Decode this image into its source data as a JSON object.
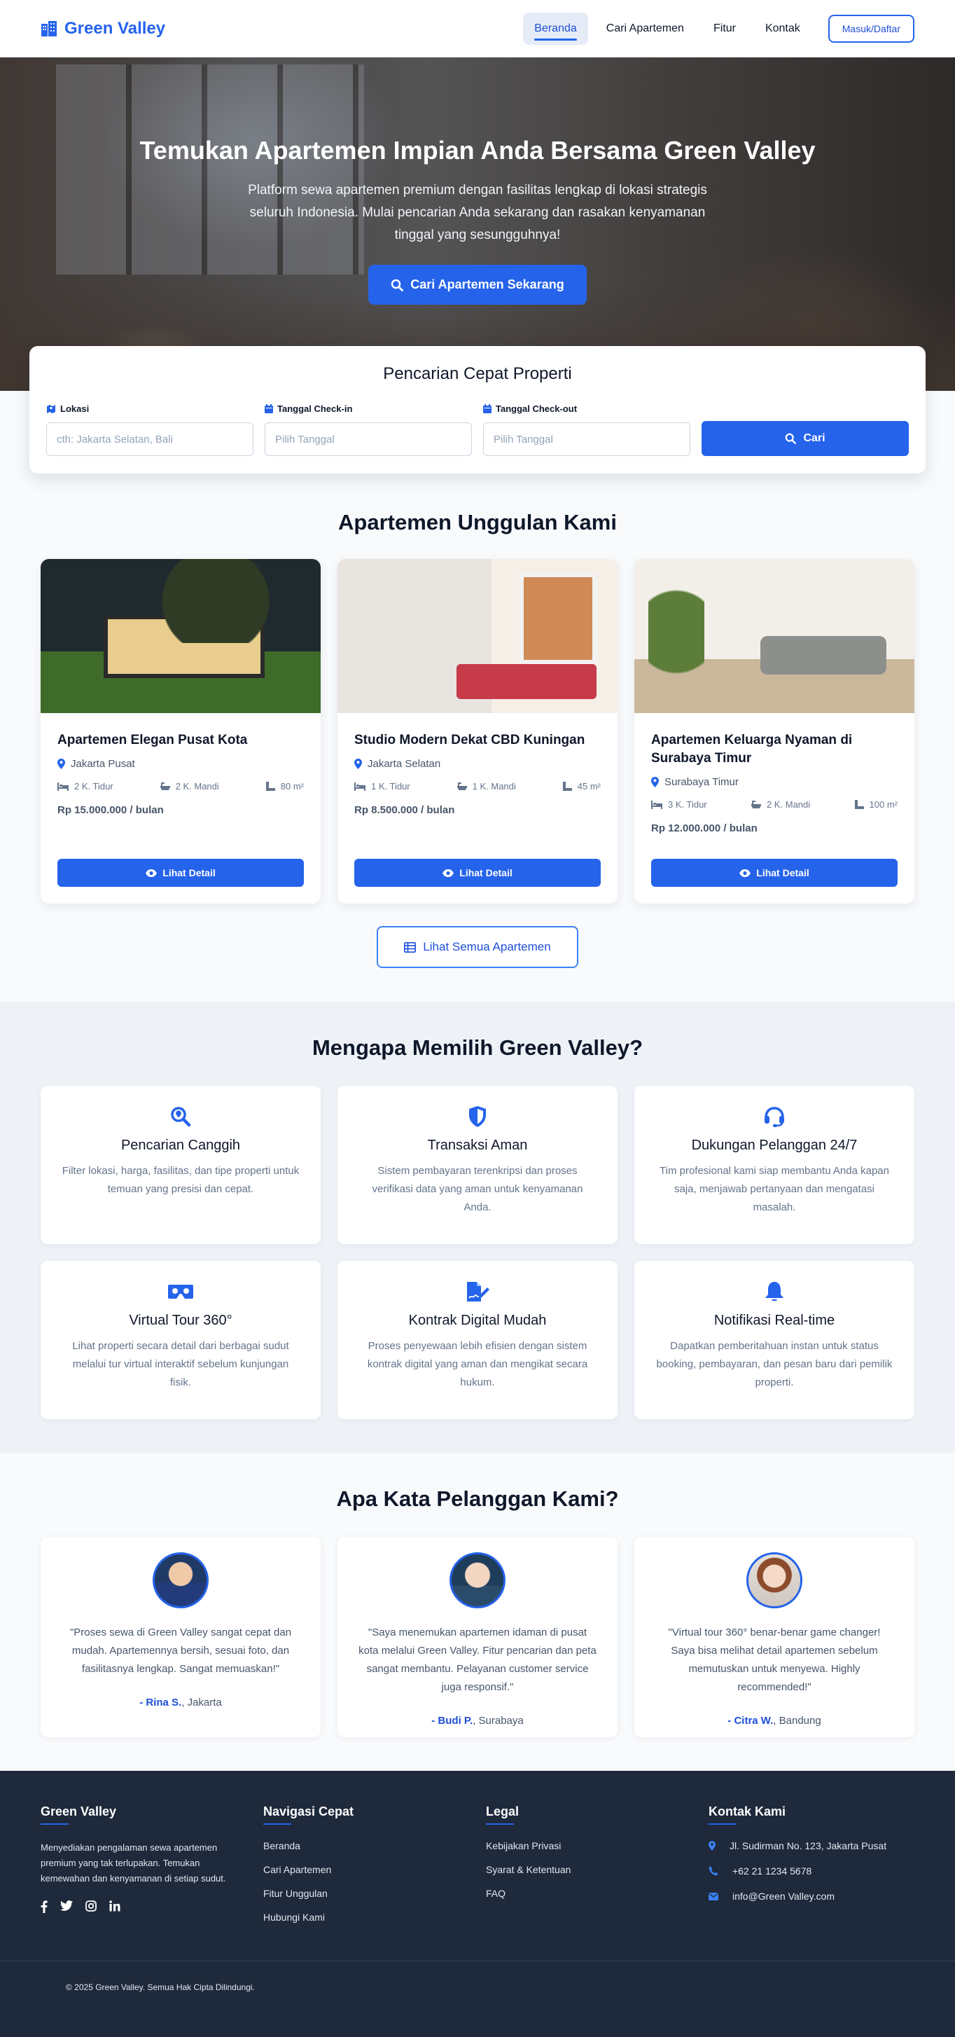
{
  "header": {
    "brand": "Green Valley",
    "nav": [
      "Beranda",
      "Cari Apartemen",
      "Fitur",
      "Kontak"
    ],
    "login": "Masuk/Daftar"
  },
  "hero": {
    "title": "Temukan Apartemen Impian Anda Bersama Green Valley",
    "subtitle": "Platform sewa apartemen premium dengan fasilitas lengkap di lokasi strategis seluruh Indonesia. Mulai pencarian Anda sekarang dan rasakan kenyamanan tinggal yang sesungguhnya!",
    "cta": "Cari Apartemen Sekarang"
  },
  "search": {
    "title": "Pencarian Cepat Properti",
    "location_label": "Lokasi",
    "location_placeholder": "cth: Jakarta Selatan, Bali",
    "checkin_label": "Tanggal Check-in",
    "checkin_placeholder": "Pilih Tanggal",
    "checkout_label": "Tanggal Check-out",
    "checkout_placeholder": "Pilih Tanggal",
    "button": "Cari"
  },
  "featured": {
    "title": "Apartemen Unggulan Kami",
    "cards": [
      {
        "title": "Apartemen Elegan Pusat Kota",
        "location": "Jakarta Pusat",
        "beds": "2 K. Tidur",
        "baths": "2 K. Mandi",
        "area": "80 m²",
        "price": "Rp 15.000.000 / bulan",
        "button": "Lihat Detail"
      },
      {
        "title": "Studio Modern Dekat CBD Kuningan",
        "location": "Jakarta Selatan",
        "beds": "1 K. Tidur",
        "baths": "1 K. Mandi",
        "area": "45 m²",
        "price": "Rp 8.500.000 / bulan",
        "button": "Lihat Detail"
      },
      {
        "title": "Apartemen Keluarga Nyaman di Surabaya Timur",
        "location": "Surabaya Timur",
        "beds": "3 K. Tidur",
        "baths": "2 K. Mandi",
        "area": "100 m²",
        "price": "Rp 12.000.000 / bulan",
        "button": "Lihat Detail"
      }
    ],
    "all_button": "Lihat Semua Apartemen"
  },
  "why": {
    "title": "Mengapa Memilih Green Valley?",
    "items": [
      {
        "title": "Pencarian Canggih",
        "desc": "Filter lokasi, harga, fasilitas, dan tipe properti untuk temuan yang presisi dan cepat."
      },
      {
        "title": "Transaksi Aman",
        "desc": "Sistem pembayaran terenkripsi dan proses verifikasi data yang aman untuk kenyamanan Anda."
      },
      {
        "title": "Dukungan Pelanggan 24/7",
        "desc": "Tim profesional kami siap membantu Anda kapan saja, menjawab pertanyaan dan mengatasi masalah."
      },
      {
        "title": "Virtual Tour 360°",
        "desc": "Lihat properti secara detail dari berbagai sudut melalui tur virtual interaktif sebelum kunjungan fisik."
      },
      {
        "title": "Kontrak Digital Mudah",
        "desc": "Proses penyewaan lebih efisien dengan sistem kontrak digital yang aman dan mengikat secara hukum."
      },
      {
        "title": "Notifikasi Real-time",
        "desc": "Dapatkan pemberitahuan instan untuk status booking, pembayaran, dan pesan baru dari pemilik properti."
      }
    ]
  },
  "testimonials": {
    "title": "Apa Kata Pelanggan Kami?",
    "items": [
      {
        "quote": "\"Proses sewa di Green Valley sangat cepat dan mudah. Apartemennya bersih, sesuai foto, dan fasilitasnya lengkap. Sangat memuaskan!\"",
        "name": "- Rina S.",
        "city": ", Jakarta"
      },
      {
        "quote": "\"Saya menemukan apartemen idaman di pusat kota melalui Green Valley. Fitur pencarian dan peta sangat membantu. Pelayanan customer service juga responsif.\"",
        "name": "- Budi P.",
        "city": ", Surabaya"
      },
      {
        "quote": "\"Virtual tour 360° benar-benar game changer! Saya bisa melihat detail apartemen sebelum memutuskan untuk menyewa. Highly recommended!\"",
        "name": "- Citra W.",
        "city": ", Bandung"
      }
    ]
  },
  "footer": {
    "about_title": "Green Valley",
    "about_text": "Menyediakan pengalaman sewa apartemen premium yang tak terlupakan. Temukan kemewahan dan kenyamanan di setiap sudut.",
    "nav_title": "Navigasi Cepat",
    "nav_links": [
      "Beranda",
      "Cari Apartemen",
      "Fitur Unggulan",
      "Hubungi Kami"
    ],
    "legal_title": "Legal",
    "legal_links": [
      "Kebijakan Privasi",
      "Syarat & Ketentuan",
      "FAQ"
    ],
    "contact_title": "Kontak Kami",
    "address": "Jl. Sudirman No. 123, Jakarta Pusat",
    "phone": "+62 21 1234 5678",
    "email": "info@Green Valley.com",
    "copyright": "© 2025 Green Valley. Semua Hak Cipta Dilindungi."
  },
  "colors": {
    "accent": "#2563eb",
    "footer_bg": "#1e293b",
    "section_bg": "#eef2f7"
  }
}
